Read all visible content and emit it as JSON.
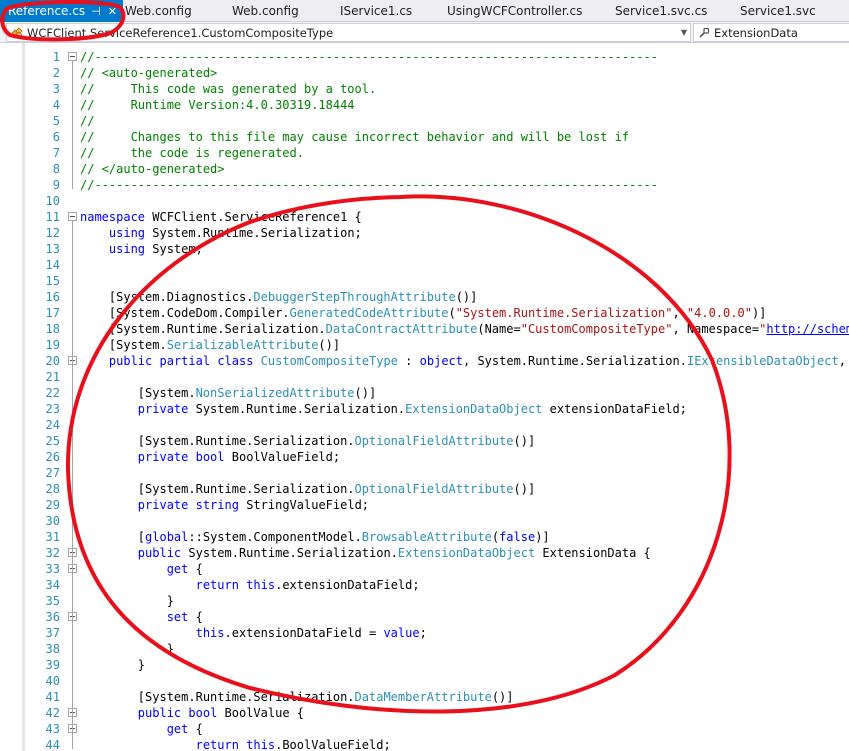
{
  "tabs": [
    {
      "label": "Reference.cs",
      "active": true
    },
    {
      "label": "Web.config"
    },
    {
      "label": "Web.config"
    },
    {
      "label": "IService1.cs"
    },
    {
      "label": "UsingWCFController.cs"
    },
    {
      "label": "Service1.svc.cs"
    },
    {
      "label": "Service1.svc"
    }
  ],
  "tab_pin_glyph": "⊣",
  "tab_close_glyph": "✕",
  "navigation": {
    "type_selector": "WCFClient.ServiceReference1.CustomCompositeType",
    "member_selector": "ExtensionData",
    "type_icon": "class-icon",
    "member_icon": "property-icon"
  },
  "editor": {
    "line_numbers": [
      "1",
      "2",
      "3",
      "4",
      "5",
      "6",
      "7",
      "8",
      "9",
      "10",
      "11",
      "12",
      "13",
      "14",
      "15",
      "16",
      "17",
      "18",
      "19",
      "20",
      "21",
      "22",
      "23",
      "24",
      "25",
      "26",
      "27",
      "28",
      "29",
      "30",
      "31",
      "32",
      "33",
      "34",
      "35",
      "36",
      "37",
      "38",
      "39",
      "40",
      "41",
      "42",
      "43",
      "44"
    ],
    "fold_markers_at_lines": [
      1,
      11,
      20,
      32,
      33,
      36,
      42,
      43
    ],
    "lines": [
      [
        [
          "c",
          "//------------------------------------------------------------------------------"
        ]
      ],
      [
        [
          "c",
          "// <auto-generated>"
        ]
      ],
      [
        [
          "c",
          "//     This code was generated by a tool."
        ]
      ],
      [
        [
          "c",
          "//     Runtime Version:4.0.30319.18444"
        ]
      ],
      [
        [
          "c",
          "//"
        ]
      ],
      [
        [
          "c",
          "//     Changes to this file may cause incorrect behavior and will be lost if"
        ]
      ],
      [
        [
          "c",
          "//     the code is regenerated."
        ]
      ],
      [
        [
          "c",
          "// </auto-generated>"
        ]
      ],
      [
        [
          "c",
          "//------------------------------------------------------------------------------"
        ]
      ],
      [],
      [
        [
          "k",
          "namespace"
        ],
        [
          "p",
          " WCFClient.ServiceReference1 {"
        ]
      ],
      [
        [
          "p",
          "    "
        ],
        [
          "k",
          "using"
        ],
        [
          "p",
          " System.Runtime.Serialization;"
        ]
      ],
      [
        [
          "p",
          "    "
        ],
        [
          "k",
          "using"
        ],
        [
          "p",
          " System;"
        ]
      ],
      [],
      [],
      [
        [
          "p",
          "    [System.Diagnostics."
        ],
        [
          "t",
          "DebuggerStepThroughAttribute"
        ],
        [
          "p",
          "()]"
        ]
      ],
      [
        [
          "p",
          "    [System.CodeDom.Compiler."
        ],
        [
          "t",
          "GeneratedCodeAttribute"
        ],
        [
          "p",
          "("
        ],
        [
          "s",
          "\"System.Runtime.Serialization\""
        ],
        [
          "p",
          ", "
        ],
        [
          "s",
          "\"4.0.0.0\""
        ],
        [
          "p",
          ")]"
        ]
      ],
      [
        [
          "p",
          "    [System.Runtime.Serialization."
        ],
        [
          "t",
          "DataContractAttribute"
        ],
        [
          "p",
          "(Name="
        ],
        [
          "s",
          "\"CustomCompositeType\""
        ],
        [
          "p",
          ", Namespace="
        ],
        [
          "s",
          "\""
        ],
        [
          "u",
          "http://schemas."
        ]
      ],
      [
        [
          "p",
          "    [System."
        ],
        [
          "t",
          "SerializableAttribute"
        ],
        [
          "p",
          "()]"
        ]
      ],
      [
        [
          "p",
          "    "
        ],
        [
          "k",
          "public"
        ],
        [
          "p",
          " "
        ],
        [
          "k",
          "partial"
        ],
        [
          "p",
          " "
        ],
        [
          "k",
          "class"
        ],
        [
          "p",
          " "
        ],
        [
          "t",
          "CustomCompositeType"
        ],
        [
          "p",
          " : "
        ],
        [
          "k",
          "object"
        ],
        [
          "p",
          ", System.Runtime.Serialization."
        ],
        [
          "t",
          "IExtensibleDataObject"
        ],
        [
          "p",
          ", Sys"
        ]
      ],
      [],
      [
        [
          "p",
          "        [System."
        ],
        [
          "t",
          "NonSerializedAttribute"
        ],
        [
          "p",
          "()]"
        ]
      ],
      [
        [
          "p",
          "        "
        ],
        [
          "k",
          "private"
        ],
        [
          "p",
          " System.Runtime.Serialization."
        ],
        [
          "t",
          "ExtensionDataObject"
        ],
        [
          "p",
          " extensionDataField;"
        ]
      ],
      [],
      [
        [
          "p",
          "        [System.Runtime.Serialization."
        ],
        [
          "t",
          "OptionalFieldAttribute"
        ],
        [
          "p",
          "()]"
        ]
      ],
      [
        [
          "p",
          "        "
        ],
        [
          "k",
          "private"
        ],
        [
          "p",
          " "
        ],
        [
          "k",
          "bool"
        ],
        [
          "p",
          " BoolValueField;"
        ]
      ],
      [],
      [
        [
          "p",
          "        [System.Runtime.Serialization."
        ],
        [
          "t",
          "OptionalFieldAttribute"
        ],
        [
          "p",
          "()]"
        ]
      ],
      [
        [
          "p",
          "        "
        ],
        [
          "k",
          "private"
        ],
        [
          "p",
          " "
        ],
        [
          "k",
          "string"
        ],
        [
          "p",
          " StringValueField;"
        ]
      ],
      [],
      [
        [
          "p",
          "        ["
        ],
        [
          "k",
          "global"
        ],
        [
          "p",
          "::System.ComponentModel."
        ],
        [
          "t",
          "BrowsableAttribute"
        ],
        [
          "p",
          "("
        ],
        [
          "k",
          "false"
        ],
        [
          "p",
          ")]"
        ]
      ],
      [
        [
          "p",
          "        "
        ],
        [
          "k",
          "public"
        ],
        [
          "p",
          " System.Runtime.Serialization."
        ],
        [
          "t",
          "ExtensionDataObject"
        ],
        [
          "p",
          " ExtensionData {"
        ]
      ],
      [
        [
          "p",
          "            "
        ],
        [
          "k",
          "get"
        ],
        [
          "p",
          " {"
        ]
      ],
      [
        [
          "p",
          "                "
        ],
        [
          "k",
          "return"
        ],
        [
          "p",
          " "
        ],
        [
          "k",
          "this"
        ],
        [
          "p",
          ".extensionDataField;"
        ]
      ],
      [
        [
          "p",
          "            }"
        ]
      ],
      [
        [
          "p",
          "            "
        ],
        [
          "k",
          "set"
        ],
        [
          "p",
          " {"
        ]
      ],
      [
        [
          "p",
          "                "
        ],
        [
          "k",
          "this"
        ],
        [
          "p",
          ".extensionDataField = "
        ],
        [
          "k",
          "value"
        ],
        [
          "p",
          ";"
        ]
      ],
      [
        [
          "p",
          "            }"
        ]
      ],
      [
        [
          "p",
          "        }"
        ]
      ],
      [],
      [
        [
          "p",
          "        [System.Runtime.Serialization."
        ],
        [
          "t",
          "DataMemberAttribute"
        ],
        [
          "p",
          "()]"
        ]
      ],
      [
        [
          "p",
          "        "
        ],
        [
          "k",
          "public"
        ],
        [
          "p",
          " "
        ],
        [
          "k",
          "bool"
        ],
        [
          "p",
          " BoolValue {"
        ]
      ],
      [
        [
          "p",
          "            "
        ],
        [
          "k",
          "get"
        ],
        [
          "p",
          " {"
        ]
      ],
      [
        [
          "p",
          "                "
        ],
        [
          "k",
          "return"
        ],
        [
          "p",
          " "
        ],
        [
          "k",
          "this"
        ],
        [
          "p",
          ".BoolValueField;"
        ]
      ]
    ]
  },
  "annotations": {
    "color": "#e8101a",
    "marks": [
      "circle-around-active-tab",
      "circle-around-class-code"
    ]
  },
  "colors": {
    "accent": "#007acc",
    "comment": "#008000",
    "keyword": "#0000ff",
    "type": "#2b91af",
    "string": "#a31515",
    "line_number": "#2b91af"
  }
}
